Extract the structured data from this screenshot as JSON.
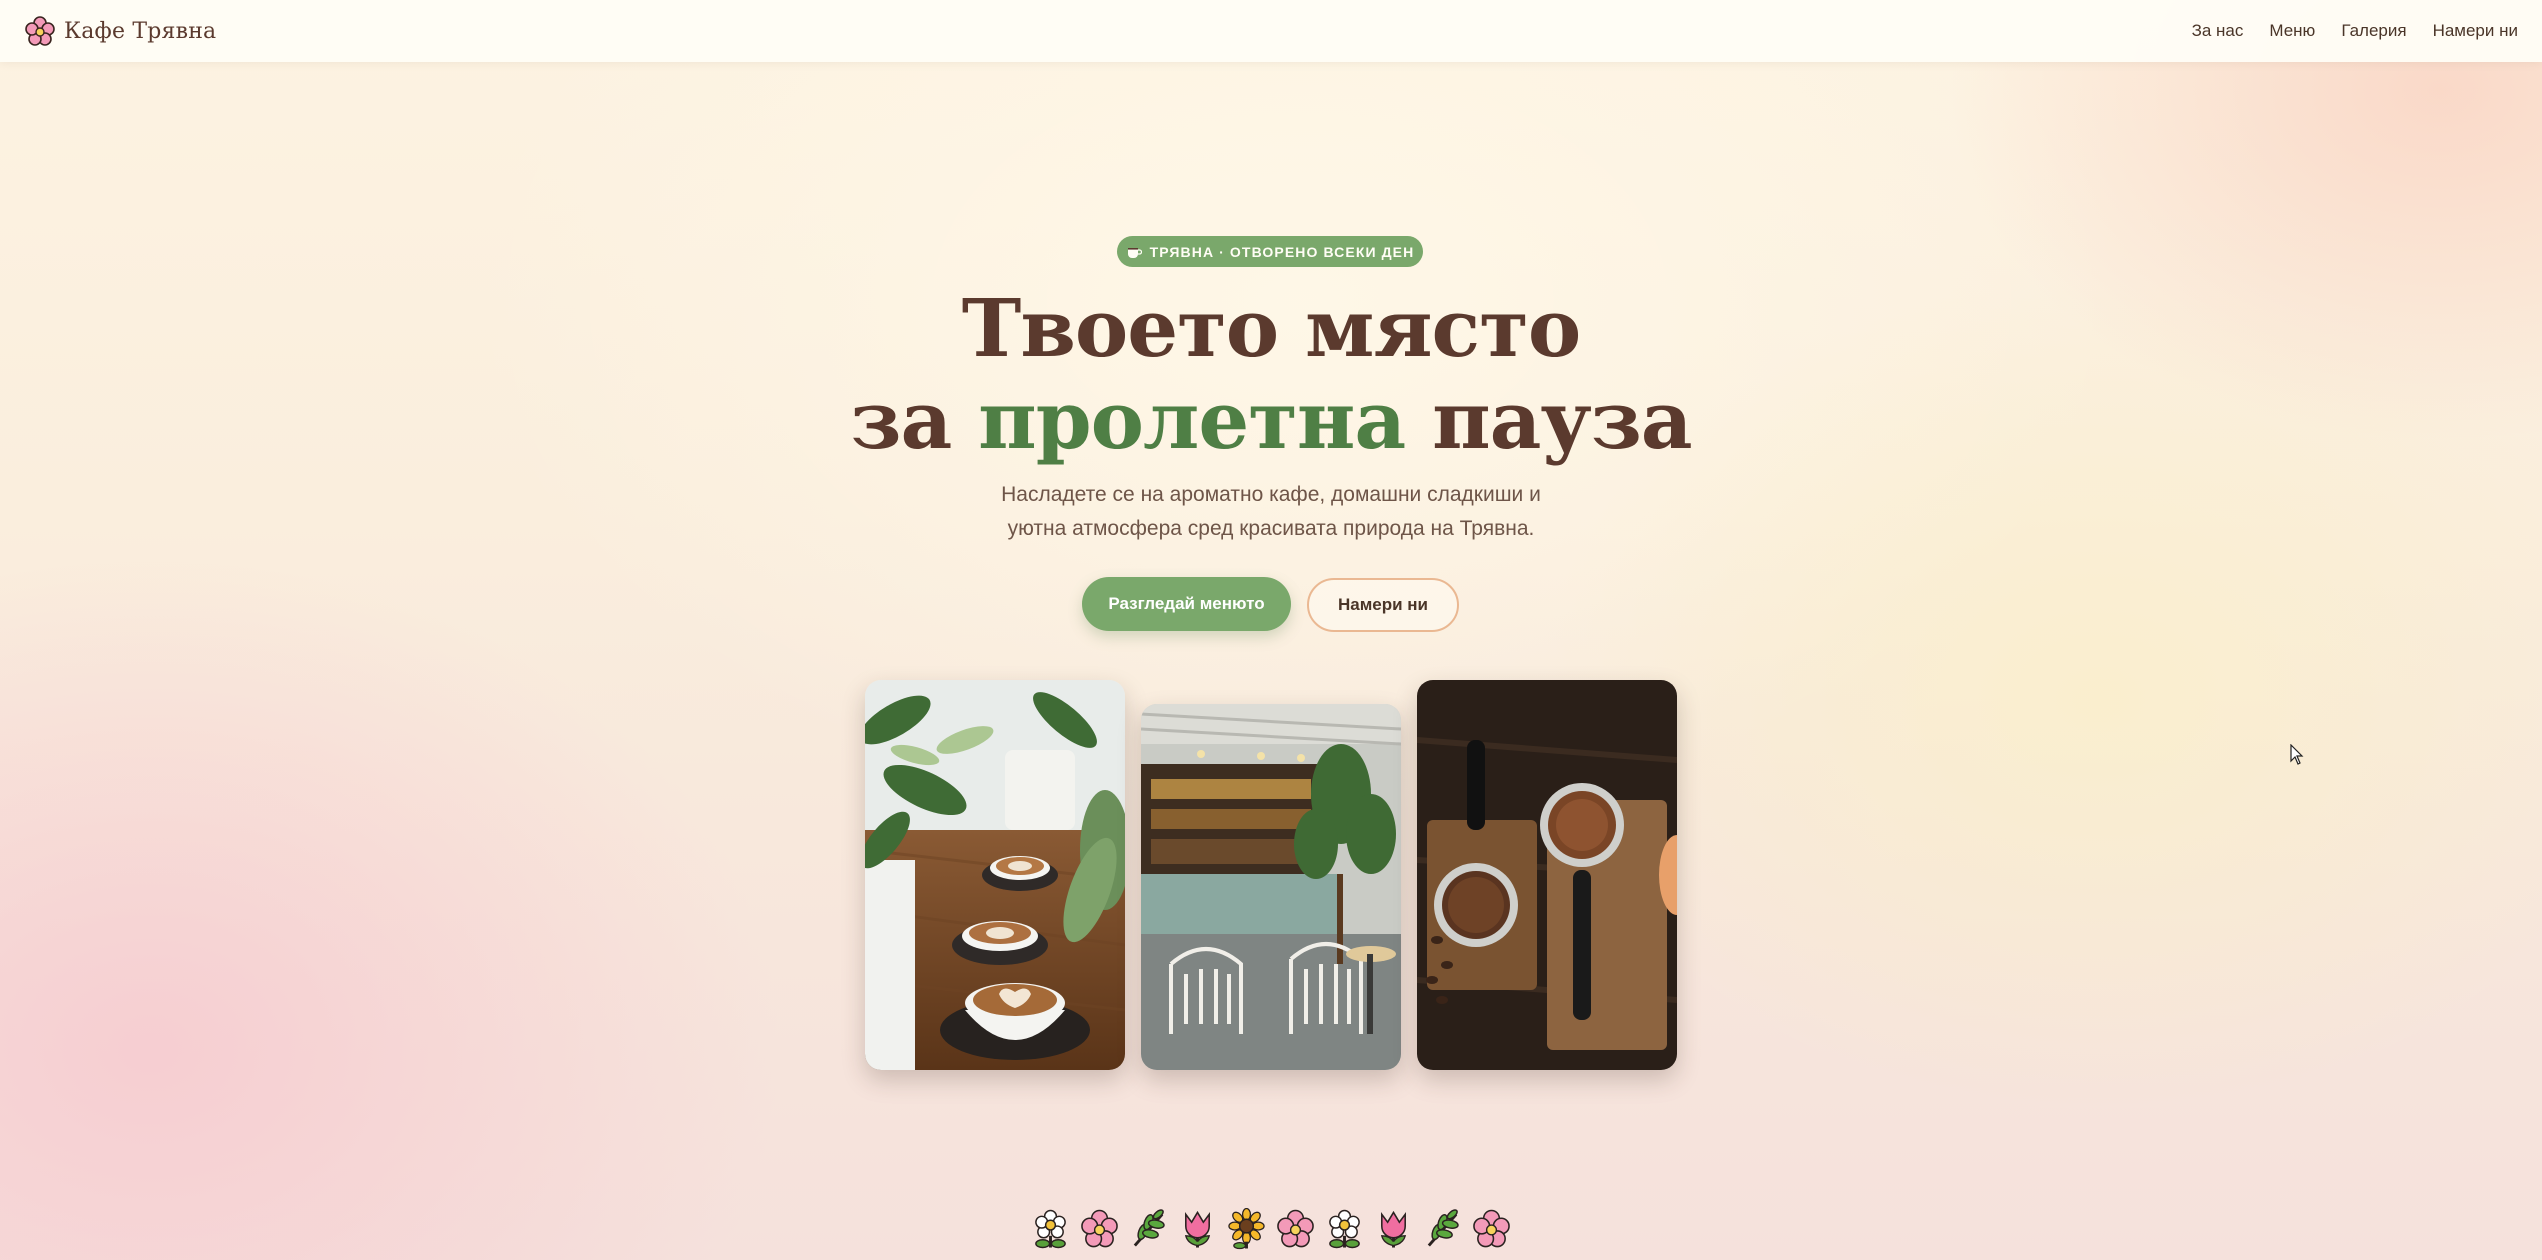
{
  "header": {
    "brand": "Кафе Трявна",
    "nav": [
      {
        "label": "За нас"
      },
      {
        "label": "Меню"
      },
      {
        "label": "Галерия"
      },
      {
        "label": "Намери ни"
      }
    ]
  },
  "hero": {
    "badge": "ТРЯВНА · ОТВОРЕНО ВСЕКИ ДЕН",
    "title_line1": "Твоето място",
    "title_line2_pre": "за ",
    "title_line2_accent": "пролетна",
    "title_line2_post": " пауза",
    "subtitle_line1": "Насладете се на ароматно кафе, домашни сладкиши и",
    "subtitle_line2": "уютна атмосфера сред красивата природа на Трявна.",
    "primary_button": "Разгледай менюто",
    "secondary_button": "Намери ни"
  },
  "gallery": {
    "photos": [
      {
        "subject": "latte cups with plants on wooden table"
      },
      {
        "subject": "cafe interior with chairs and plants"
      },
      {
        "subject": "espresso portafilters on wooden board"
      }
    ]
  },
  "decor": {
    "flower_row": [
      "daisy-icon",
      "cherry-blossom-icon",
      "herb-icon",
      "tulip-icon",
      "sunflower-icon",
      "cherry-blossom-icon",
      "daisy-icon",
      "tulip-icon",
      "herb-icon",
      "cherry-blossom-icon"
    ]
  },
  "colors": {
    "accent_green": "#7aa86b",
    "title_brown": "#5b3a2e",
    "title_green": "#4f7f45",
    "outline_peach": "#eab892"
  }
}
